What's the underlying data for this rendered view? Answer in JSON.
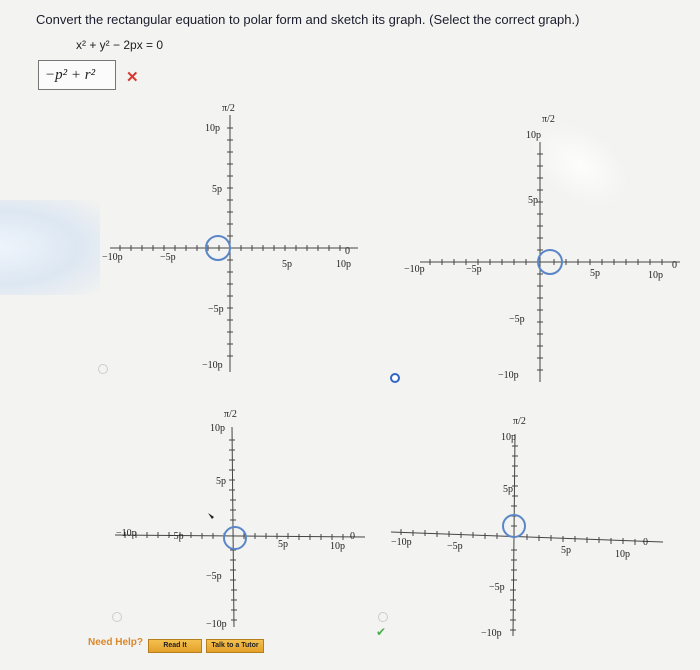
{
  "question": "Convert the rectangular equation to polar form and sketch its graph. (Select the correct graph.)",
  "equation": "x² + y² − 2px = 0",
  "answer": {
    "value": "−p² + r²",
    "status_icon": "red-x-icon",
    "status_color": "#d43a2f"
  },
  "graph_labels": {
    "theta_top": "π/2",
    "theta_right": "0",
    "ten_p": "10p",
    "five_p": "5p",
    "neg_five_p": "−5p",
    "neg_ten_p": "−10p"
  },
  "graph_options": [
    {
      "id": "top-left",
      "selected": false
    },
    {
      "id": "top-right",
      "selected": true
    },
    {
      "id": "bottom-left",
      "selected": false
    },
    {
      "id": "bottom-right",
      "selected": false
    }
  ],
  "footer": {
    "need_help": "Need Help?",
    "read_it": "Read It",
    "talk_to_tutor": "Talk to a Tutor"
  },
  "colors": {
    "accent": "#4a7fd0",
    "circle_outline": "#5a86c8",
    "help_button": "#e8aa34"
  }
}
